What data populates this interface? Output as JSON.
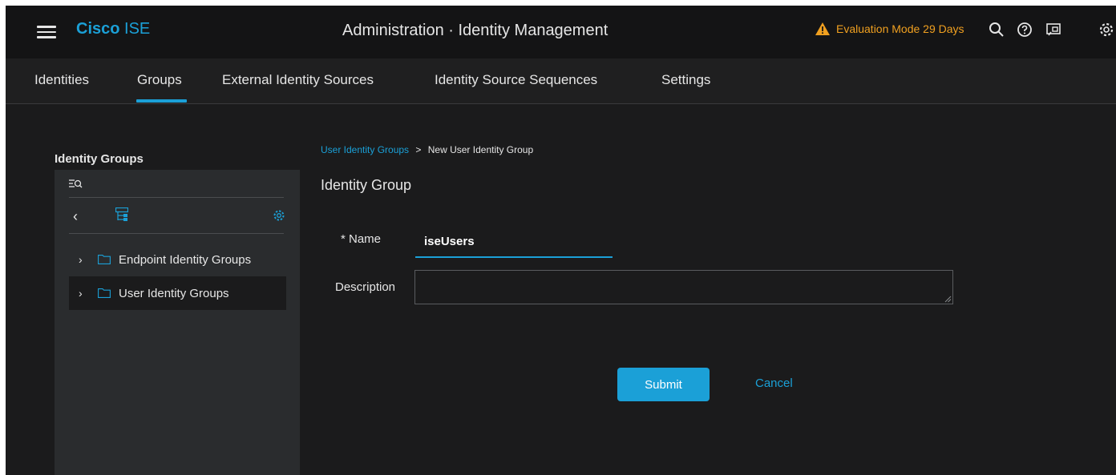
{
  "header": {
    "brand_bold": "Cisco",
    "brand_light": "ISE",
    "title": "Administration · Identity Management",
    "eval_text": "Evaluation Mode 29 Days",
    "icons": [
      "menu-icon",
      "warning-icon",
      "search-icon",
      "help-icon",
      "dashboard-icon",
      "settings-icon"
    ]
  },
  "tabs": [
    {
      "label": "Identities",
      "active": false
    },
    {
      "label": "Groups",
      "active": true
    },
    {
      "label": "External Identity Sources",
      "active": false
    },
    {
      "label": "Identity Source Sequences",
      "active": false
    },
    {
      "label": "Settings",
      "active": false
    }
  ],
  "sidebar": {
    "heading": "Identity Groups",
    "items": [
      {
        "label": "Endpoint Identity Groups",
        "selected": false
      },
      {
        "label": "User Identity Groups",
        "selected": true
      }
    ]
  },
  "breadcrumb": {
    "link": "User Identity Groups",
    "separator": ">",
    "current": "New User Identity Group"
  },
  "form": {
    "title": "Identity Group",
    "name_label": "* Name",
    "name_value": "iseUsers",
    "description_label": "Description",
    "description_value": "",
    "submit_label": "Submit",
    "cancel_label": "Cancel"
  },
  "colors": {
    "accent": "#1ba0d7",
    "warning": "#f0a020",
    "background": "#1b1b1c",
    "panel": "#2a2c2e"
  }
}
